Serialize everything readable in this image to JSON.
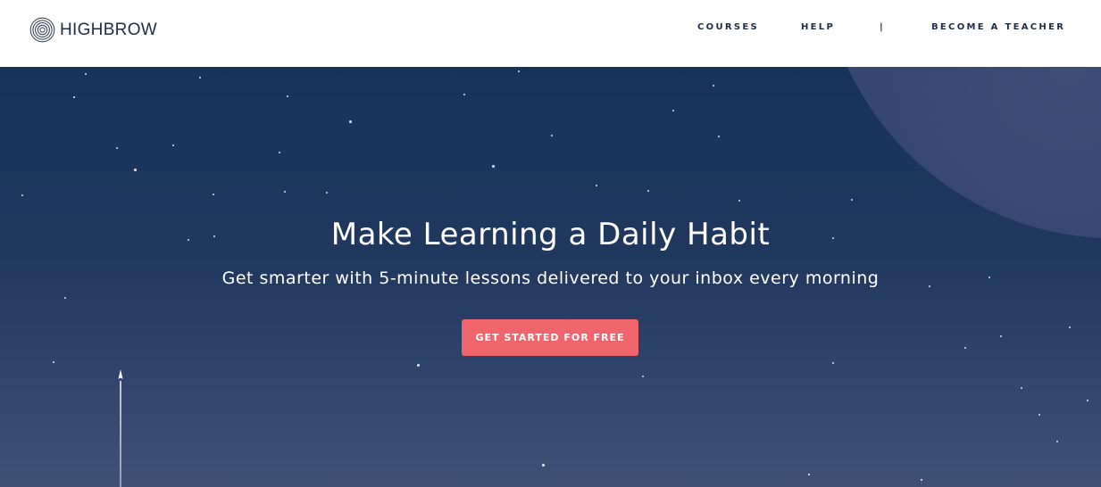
{
  "header": {
    "logo_text": "HIGHBROW",
    "nav": {
      "courses": "COURSES",
      "help": "HELP",
      "separator": "|",
      "become_teacher": "BECOME A TEACHER"
    }
  },
  "hero": {
    "headline": "Make Learning a Daily Habit",
    "subheadline": "Get smarter with 5-minute lessons delivered to your inbox every morning",
    "cta_label": "GET STARTED FOR FREE"
  },
  "colors": {
    "brand_navy": "#1f2d44",
    "hero_background": "#17325a",
    "cta_background": "#f0656c",
    "text_on_dark": "#ffffff"
  },
  "icons": {
    "logo": "concentric-circles-logo-icon",
    "rocket": "rocket-icon"
  }
}
